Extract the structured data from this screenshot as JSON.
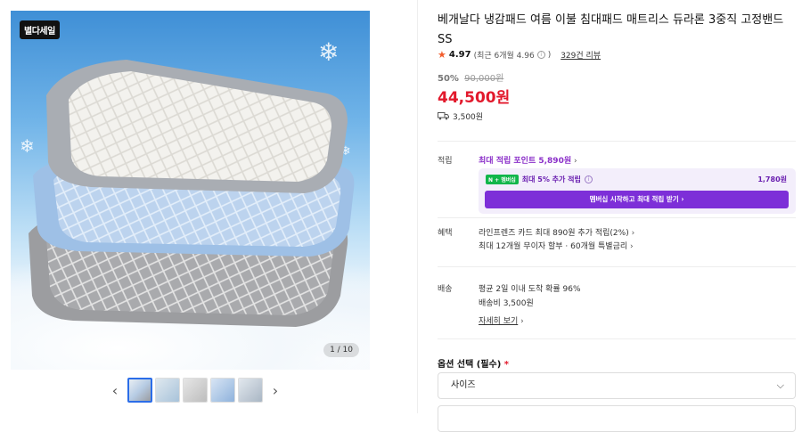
{
  "gallery": {
    "badge": "별다세일",
    "counter": "1 / 10",
    "prev": "‹",
    "next": "›",
    "thumbs": [
      "#c8d9ea",
      "#d6e4ef",
      "#d9d9d9",
      "#b9cde6",
      "#cfd6de"
    ]
  },
  "product": {
    "title": "베개날다 냉감패드 여름 이불 침대패드 매트리스 듀라론 3중직 고정밴드 SS",
    "rating": "4.97",
    "rating_recent": "(최근 6개월 4.96",
    "rating_close": ")",
    "reviews": "329건 리뷰",
    "discount": "50%",
    "original_price": "90,000원",
    "price": "44,500원",
    "shipping": "3,500원"
  },
  "benefits": {
    "points_label": "적립",
    "points_link": "최대 적립 포인트 5,890원",
    "member_badge": "N + 멤버십",
    "member_text_pre": "최대 5% 추가 적립",
    "member_amount": "1,780원",
    "member_button": "멤버십 시작하고 최대 적립 받기",
    "perks_label": "혜택",
    "perk1": "라인프렌즈 카드 최대 890원 추가 적립(2%)",
    "perk2": "최대 12개월 무이자 할부 · 60개월 특별금리",
    "delivery_label": "배송",
    "delivery1": "평균 2일 이내 도착 확률 96%",
    "delivery2": "배송비 3,500원",
    "delivery_more": "자세히 보기"
  },
  "options": {
    "title": "옵션 선택 (필수)",
    "required_mark": "*",
    "select_value": "사이즈"
  },
  "colors": {
    "price_red": "#e2192c",
    "member_purple": "#7d2fd8",
    "star": "#f25c2b"
  }
}
